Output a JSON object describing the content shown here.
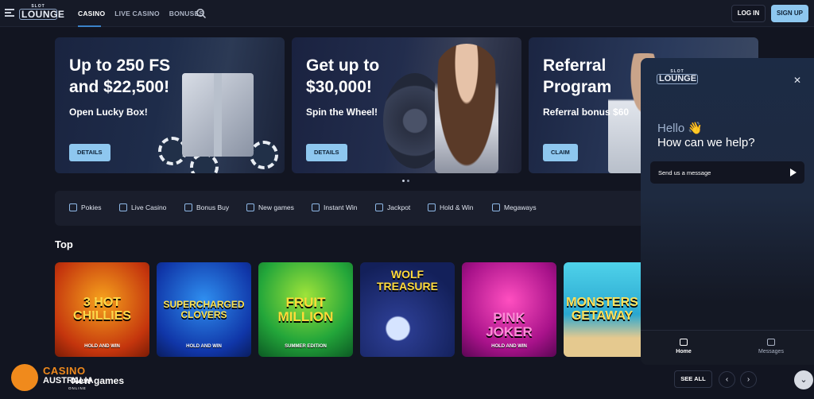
{
  "header": {
    "logo_top": "SLOT",
    "logo_main": "LOUNGE",
    "nav": [
      "CASINO",
      "LIVE CASINO",
      "BONUSES"
    ],
    "login": "LOG IN",
    "signup": "SIGN UP"
  },
  "promos": [
    {
      "title": "Up to 250 FS\nand $22,500!",
      "sub": "Open Lucky Box!",
      "button": "DETAILS"
    },
    {
      "title": "Get up to\n$30,000!",
      "sub": "Spin the Wheel!",
      "button": "DETAILS"
    },
    {
      "title": "Referral\nProgram",
      "sub": "Referral bonus $60",
      "button": "CLAIM"
    }
  ],
  "categories": [
    "Pokies",
    "Live Casino",
    "Bonus Buy",
    "New games",
    "Instant Win",
    "Jackpot",
    "Hold & Win",
    "Megaways"
  ],
  "top_title": "Top",
  "games": [
    {
      "title": "3 HOT\nCHILLIES",
      "sub": "HOLD AND WIN"
    },
    {
      "title": "SUPERCHARGED\nCLOVERS",
      "sub": "HOLD AND WIN"
    },
    {
      "title": "FRUIT\nMILLION",
      "sub": "SUMMER EDITION"
    },
    {
      "title": "WOLF\nTREASURE",
      "sub": ""
    },
    {
      "title": "PINK\nJOKER",
      "sub": "HOLD AND WIN"
    },
    {
      "title": "MONSTERS\nGETAWAY",
      "sub": ""
    }
  ],
  "new_games": "New games",
  "see_all": "SEE ALL",
  "watermark": {
    "line1": "CASINO",
    "line2": "AUSTRALIA",
    "line3": "ONLINE"
  },
  "chat": {
    "logo_top": "SLOT",
    "logo_main": "LOUNGE",
    "hello": "Hello 👋",
    "help": "How can we help?",
    "message": "Send us a message",
    "tab_home": "Home",
    "tab_messages": "Messages"
  },
  "colors": {
    "accent": "#8ec7ef",
    "background": "#121521",
    "brand_orange": "#f08a1c"
  }
}
